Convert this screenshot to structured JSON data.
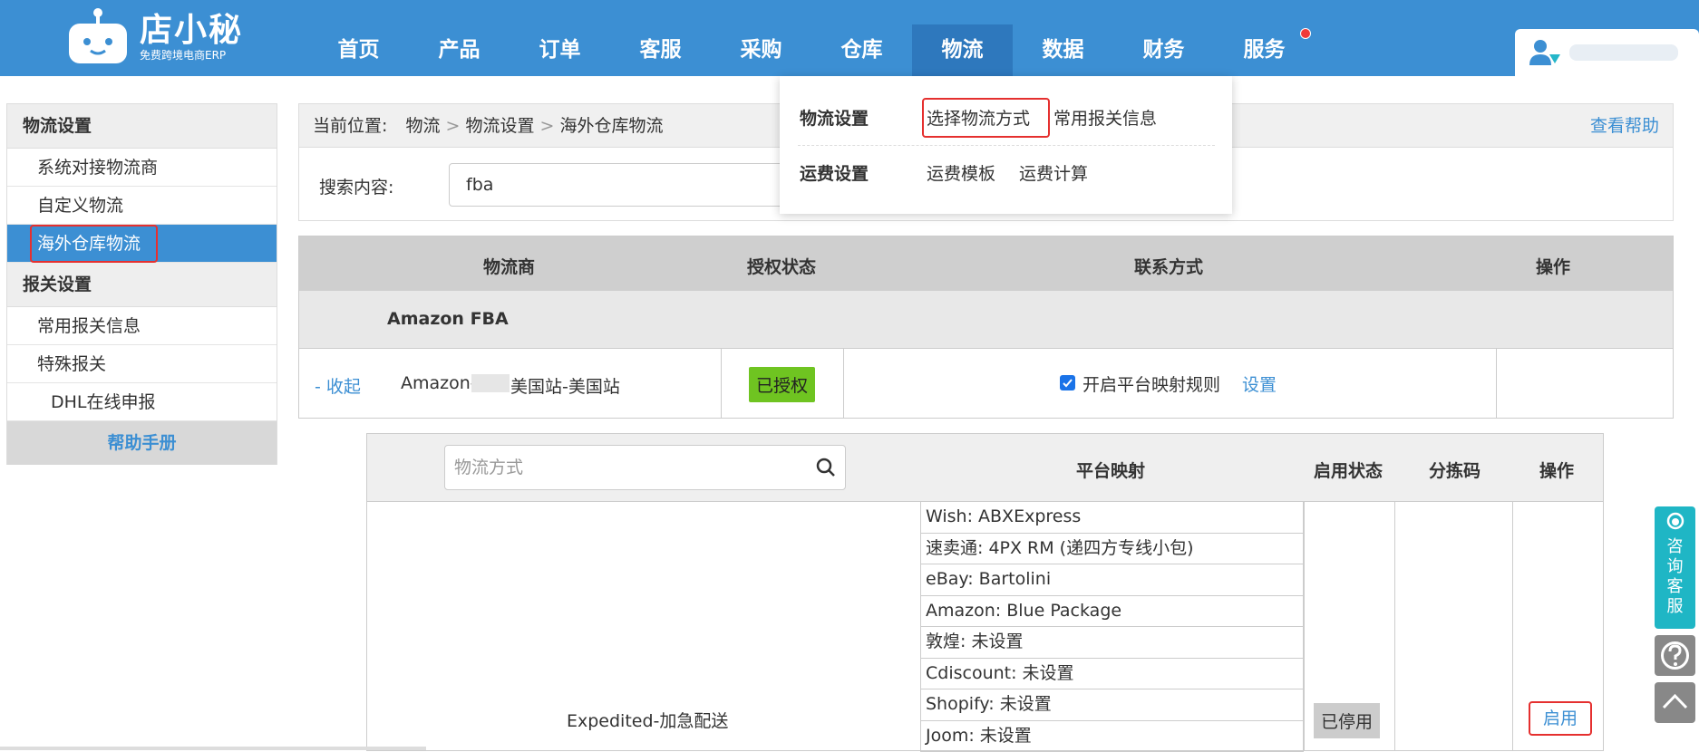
{
  "logo": {
    "name": "店小秘",
    "sub": "免费跨境电商ERP"
  },
  "nav": [
    "首页",
    "产品",
    "订单",
    "客服",
    "采购",
    "仓库",
    "物流",
    "数据",
    "财务",
    "服务"
  ],
  "sidebar": {
    "section1": "物流设置",
    "items1": [
      "系统对接物流商",
      "自定义物流",
      "海外仓库物流"
    ],
    "section2": "报关设置",
    "items2": [
      "常用报关信息",
      "特殊报关"
    ],
    "sub": "DHL在线申报",
    "help": "帮助手册"
  },
  "crumb": {
    "label": "当前位置:",
    "c1": "物流",
    "c2": "物流设置",
    "c3": "海外仓库物流",
    "help": "查看帮助"
  },
  "search": {
    "label": "搜索内容:",
    "value": "fba"
  },
  "dropdown": {
    "h1": "物流设置",
    "a1": "选择物流方式",
    "a2": "常用报关信息",
    "h2": "运费设置",
    "b1": "运费模板",
    "b2": "运费计算"
  },
  "table1": {
    "headers": [
      "物流商",
      "授权状态",
      "联系方式",
      "操作"
    ],
    "group": "Amazon FBA",
    "collapse": "- 收起",
    "provider_a": "Amazon-",
    "provider_b": "美国站-美国站",
    "auth": "已授权",
    "mapping": "开启平台映射规则",
    "settings": "设置"
  },
  "table2": {
    "placeholder": "物流方式",
    "headers": [
      "平台映射",
      "启用状态",
      "分拣码",
      "操作"
    ],
    "method": "Expedited-加急配送",
    "mappings": [
      "Wish:  ABXExpress",
      "速卖通:  4PX RM (递四方专线小包)",
      "eBay:  Bartolini",
      "Amazon:  Blue Package",
      "敦煌:  未设置",
      "Cdiscount:  未设置",
      "Shopify:  未设置",
      "Joom:  未设置"
    ],
    "status": "已停用",
    "action": "启用"
  },
  "float": {
    "consult": "咨询客服"
  },
  "colors": {
    "brand": "#3c8fd3",
    "alert": "#e5302f",
    "auth": "#6fc421"
  }
}
